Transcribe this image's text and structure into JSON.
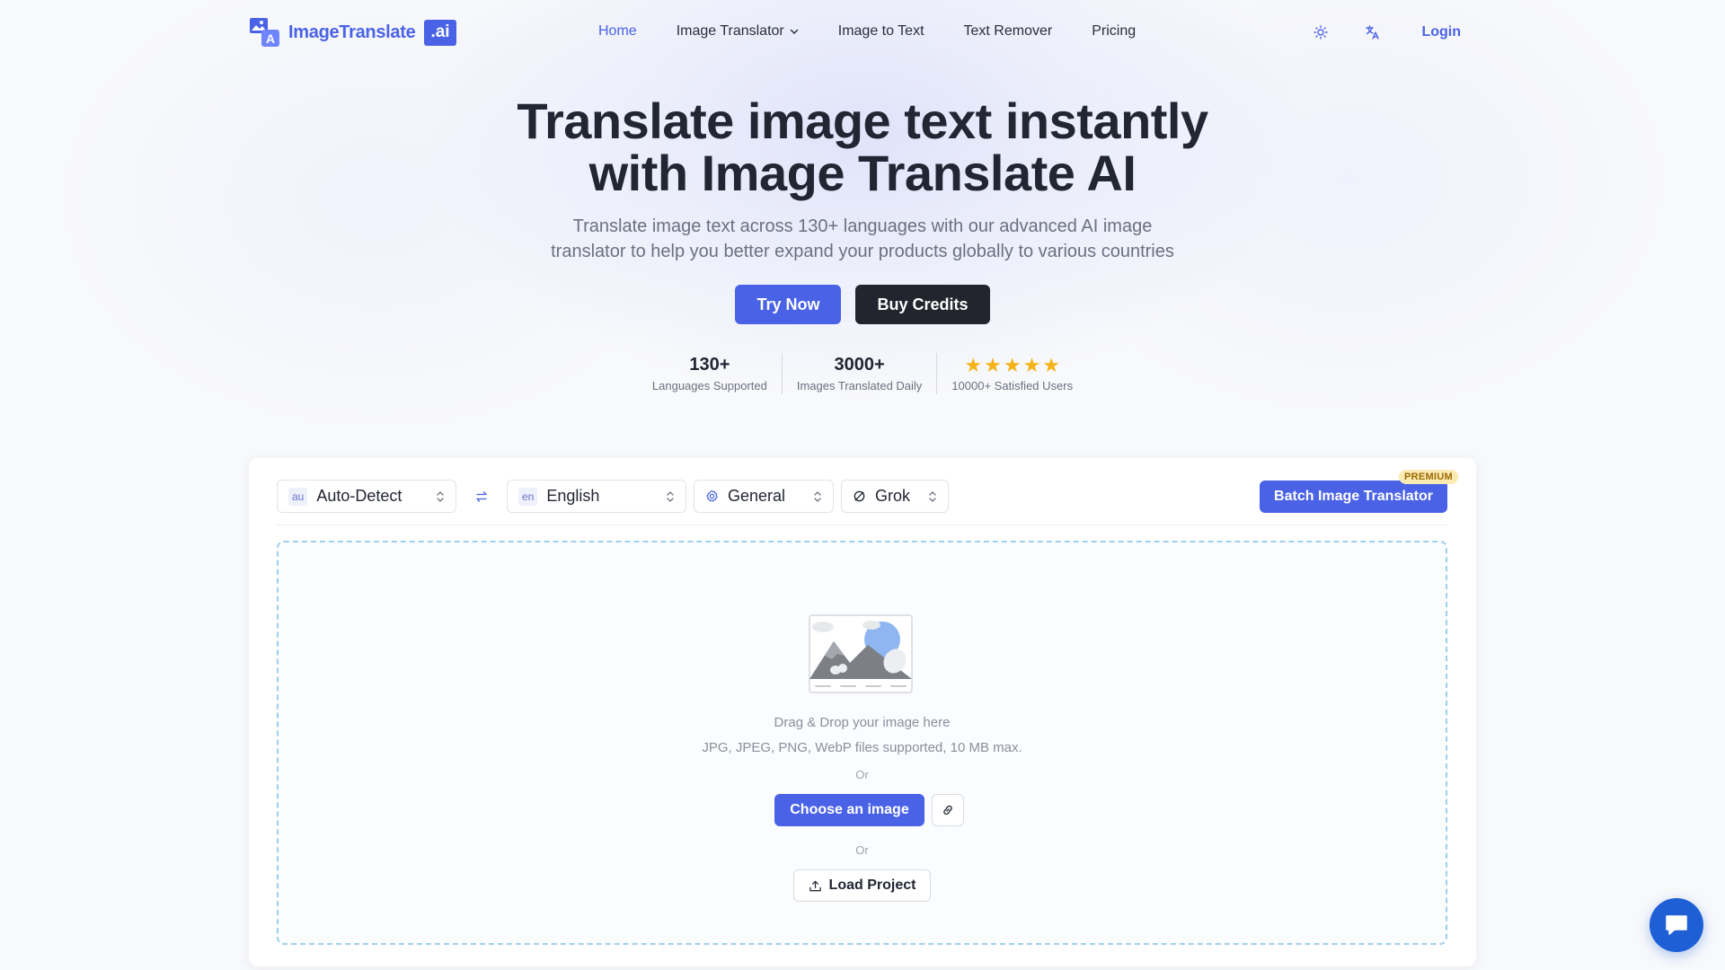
{
  "header": {
    "logo_text": "ImageTranslate",
    "logo_badge": ".ai",
    "nav": [
      {
        "label": "Home",
        "active": true
      },
      {
        "label": "Image Translator",
        "dropdown": true
      },
      {
        "label": "Image to Text"
      },
      {
        "label": "Text Remover"
      },
      {
        "label": "Pricing"
      }
    ],
    "login_label": "Login",
    "icons": [
      "sun-icon",
      "translate-icon"
    ]
  },
  "hero": {
    "title_line1": "Translate image text instantly",
    "title_line2": "with Image Translate AI",
    "subtitle_line1": "Translate image text across 130+ languages with our advanced AI image",
    "subtitle_line2": "translator to help you better expand your products globally to various countries",
    "try_label": "Try Now",
    "buy_label": "Buy Credits",
    "stats": [
      {
        "value": "130+",
        "label": "Languages Supported"
      },
      {
        "value": "3000+",
        "label": "Images Translated Daily"
      },
      {
        "rating_stars": 5,
        "label": "10000+ Satisfied Users"
      }
    ]
  },
  "translator": {
    "source": {
      "code": "au",
      "label": "Auto-Detect"
    },
    "target": {
      "code": "en",
      "label": "English"
    },
    "mode": {
      "label": "General"
    },
    "model": {
      "label": "Grok"
    },
    "batch_label": "Batch Image Translator",
    "premium_label": "PREMIUM",
    "dropzone": {
      "text1": "Drag & Drop your image here",
      "text2": "JPG, JPEG, PNG, WebP files supported, 10 MB max.",
      "or1": "Or",
      "choose_label": "Choose an image",
      "or2": "Or",
      "load_label": "Load Project"
    }
  },
  "colors": {
    "accent": "#4a62e6",
    "dark_button": "#22252e",
    "star": "#f5b21b",
    "dropzone_border": "#9fd0ea",
    "chat_fab": "#1f5fd6"
  }
}
